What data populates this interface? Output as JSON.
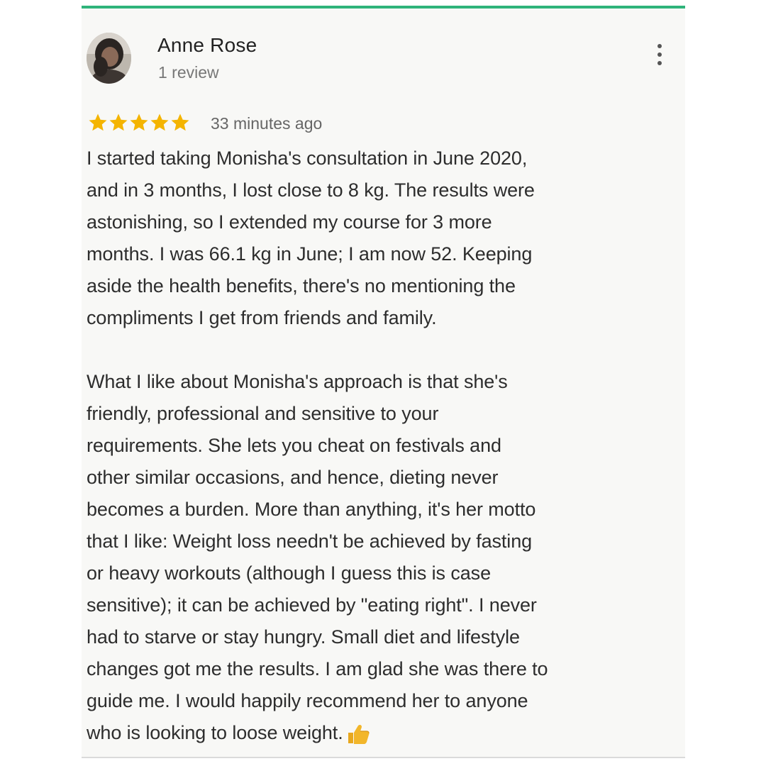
{
  "review": {
    "reviewer_name": "Anne Rose",
    "review_count": "1 review",
    "rating": 5,
    "rating_max": 5,
    "time_ago": "33 minutes ago",
    "paragraphs": [
      "I started taking Monisha's consultation in June 2020,\nand in 3 months, I lost close to 8 kg. The results were\nastonishing, so I extended my course for 3 more\nmonths. I was 66.1 kg in June; I am now 52. Keeping\naside the health benefits, there's no mentioning the\ncompliments I get from friends and family.",
      "What I like about Monisha's approach is that she's\nfriendly, professional and sensitive to your\nrequirements. She lets you cheat on festivals and\nother similar occasions, and hence, dieting never\nbecomes a burden. More than anything, it's her motto\nthat I like: Weight loss needn't be achieved by fasting\nor heavy workouts (although I guess this is case\nsensitive); it can be achieved by \"eating right\". I never\nhad to starve or stay hungry. Small diet and lifestyle\nchanges got me the results. I am glad she was there to\nguide me. I would happily recommend her to anyone\nwho is looking to loose weight."
    ],
    "trailing_emoji": "thumbs-up-icon"
  },
  "colors": {
    "accent_bar": "#2fb47a",
    "star": "#f4b400",
    "card_background": "#f8f8f6",
    "text": "#2d2d2d",
    "muted_text": "#777777"
  },
  "icons": {
    "more_menu": "more-vertical-icon",
    "star": "star-icon",
    "avatar": "avatar"
  }
}
